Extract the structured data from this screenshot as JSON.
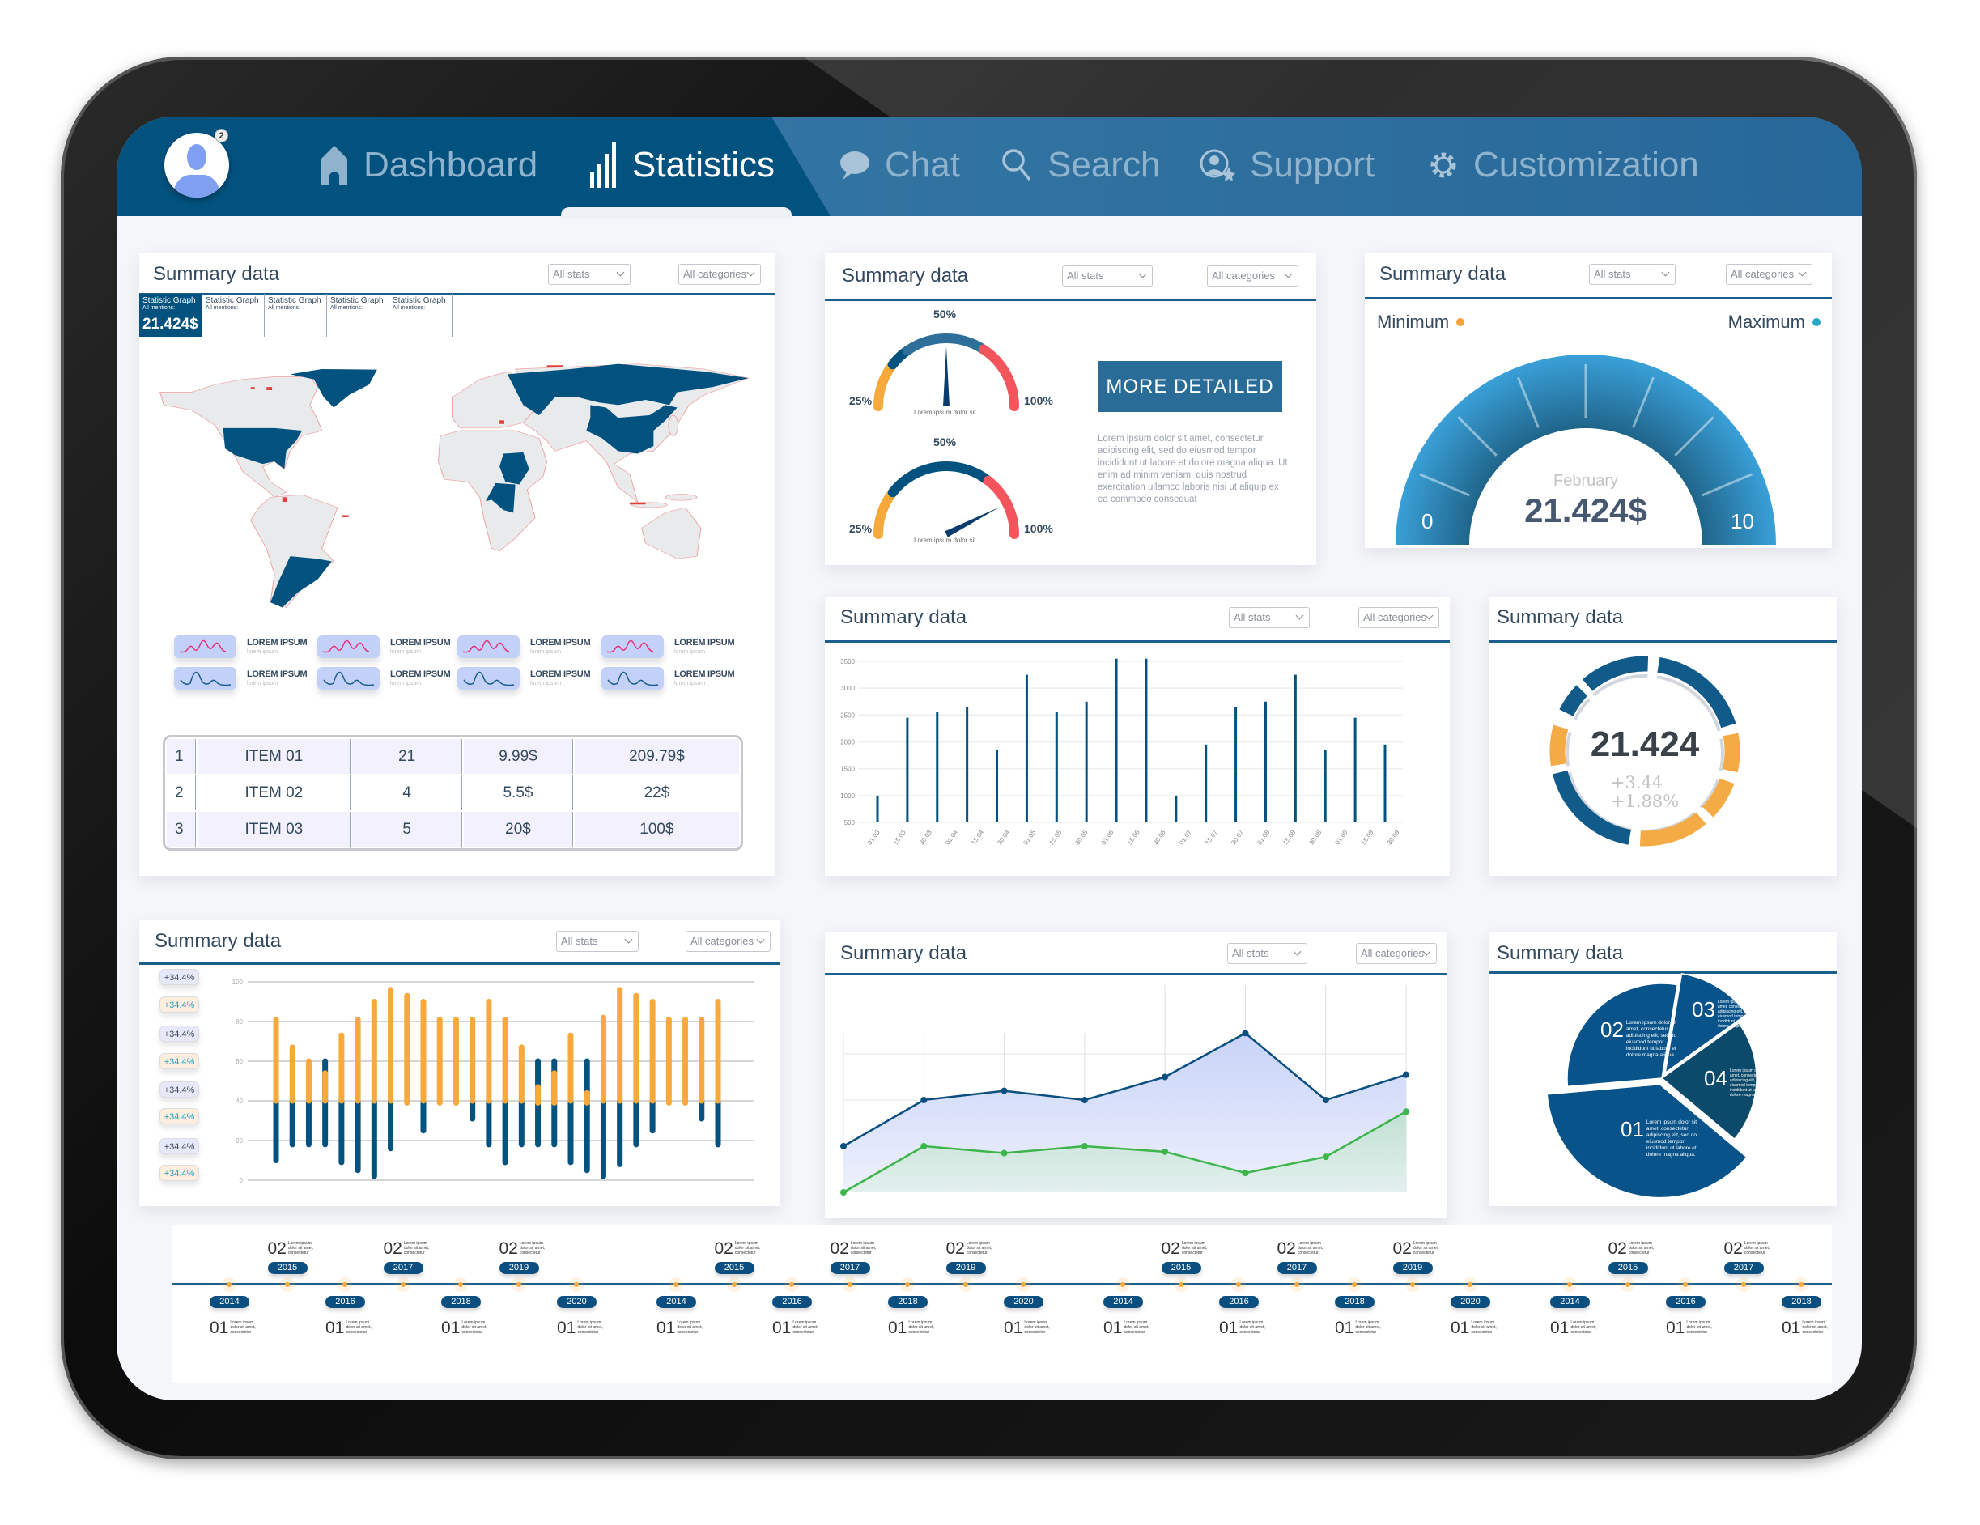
{
  "nav": {
    "notification_count": "2",
    "items": [
      {
        "label": "Dashboard",
        "icon": "home-icon"
      },
      {
        "label": "Statistics",
        "icon": "bar-chart-icon",
        "active": true
      },
      {
        "label": "Chat",
        "icon": "chat-bubble-icon"
      },
      {
        "label": "Search",
        "icon": "search-icon"
      },
      {
        "label": "Support",
        "icon": "support-icon"
      },
      {
        "label": "Customization",
        "icon": "gear-icon"
      }
    ]
  },
  "colors": {
    "navy": "#02527f",
    "orange": "#f7a93b",
    "red": "#f4545b",
    "light_blue": "#3aa0d8",
    "green": "#3db54a"
  },
  "map_panel": {
    "title": "Summary data",
    "stats_select": "All stats",
    "categories_select": "All categories",
    "tabs": [
      {
        "title": "Statistic Graph",
        "sub": "All mentions:",
        "value": "21.424$",
        "active": true
      },
      {
        "title": "Statistic Graph",
        "sub": "All mentions:"
      },
      {
        "title": "Statistic Graph",
        "sub": "All mentions:"
      },
      {
        "title": "Statistic Graph",
        "sub": "All mentions:"
      },
      {
        "title": "Statistic Graph",
        "sub": "All mentions:"
      }
    ],
    "sparklines": [
      {
        "title": "LOREM IPSUM",
        "sub": "lorem ipsum",
        "color": "#e8327c"
      },
      {
        "title": "LOREM IPSUM",
        "sub": "lorem ipsum",
        "color": "#e8327c"
      },
      {
        "title": "LOREM IPSUM",
        "sub": "lorem ipsum",
        "color": "#e8327c"
      },
      {
        "title": "LOREM IPSUM",
        "sub": "lorem ipsum",
        "color": "#e8327c"
      },
      {
        "title": "LOREM IPSUM",
        "sub": "lorem ipsum",
        "color": "#1a5d8c"
      },
      {
        "title": "LOREM IPSUM",
        "sub": "lorem ipsum",
        "color": "#1a5d8c"
      },
      {
        "title": "LOREM IPSUM",
        "sub": "lorem ipsum",
        "color": "#1a5d8c"
      },
      {
        "title": "LOREM IPSUM",
        "sub": "lorem ipsum",
        "color": "#1a5d8c"
      }
    ],
    "table": [
      [
        "1",
        "ITEM 01",
        "21",
        "9.99$",
        "209.79$"
      ],
      [
        "2",
        "ITEM 02",
        "4",
        "5.5$",
        "22$"
      ],
      [
        "3",
        "ITEM 03",
        "5",
        "20$",
        "100$"
      ]
    ]
  },
  "gauge_panel": {
    "title": "Summary data",
    "stats_select": "All stats",
    "categories_select": "All categories",
    "gauges": [
      {
        "label_min": "25%",
        "label_mid": "50%",
        "label_max": "100%",
        "caption": "Lorem ipsum  dolor sit",
        "needle_fraction": 0.5
      },
      {
        "label_min": "25%",
        "label_mid": "50%",
        "label_max": "100%",
        "caption": "Lorem ipsum  dolor sit",
        "needle_fraction": 0.85
      }
    ],
    "button": "MORE  DETAILED",
    "text": "Lorem ipsum dolor sit amet, consectetur adipiscing elit, sed do eiusmod tempor incididunt ut labore et dolore magna aliqua. Ut enim ad minim veniam, quis nostrud exercitation ullamco laboris nisi ut aliquip ex ea commodo consequat"
  },
  "meter_panel": {
    "title": "Summary data",
    "stats_select": "All stats",
    "categories_select": "All categories",
    "minimum": "Minimum",
    "maximum": "Maximum",
    "min_color": "#f7a23b",
    "max_color": "#28a9c9",
    "scale_min": "0",
    "scale_max": "10",
    "month": "February",
    "value": "21.424$"
  },
  "donut_panel": {
    "title": "Summary data",
    "value": "21.424",
    "delta": "+3.44",
    "delta_pct": "+1.88%"
  },
  "bars_panel": {
    "title": "Summary data",
    "stats_select": "All stats",
    "categories_select": "All categories"
  },
  "stacked_panel": {
    "title": "Summary data",
    "stats_select": "All stats",
    "categories_select": "All categories",
    "badges": [
      "+34.4%",
      "+34.4%",
      "+34.4%",
      "+34.4%",
      "+34.4%",
      "+34.4%",
      "+34.4%",
      "+34.4%"
    ]
  },
  "line_panel": {
    "title": "Summary data",
    "stats_select": "All stats",
    "categories_select": "All categories"
  },
  "pie_panel": {
    "title": "Summary data",
    "slices": [
      {
        "number": "01",
        "text": "Lorem ipsum dolor sit amet, consectetur adipiscing elit, sed do eiusmod tempor incididunt ut labore et dolore magna aliqua."
      },
      {
        "number": "02",
        "text": "Lorem ipsum dolor sit amet, consectetur adipiscing elit, sed do eiusmod tempor incididunt ut labore et dolore magna aliqua."
      },
      {
        "number": "03",
        "text": "Lorem ipsum dolor sit amet, consectetur adipiscing elit, sed do eiusmod tempor incididunt ut labore et dolore magna aliqua."
      },
      {
        "number": "04",
        "text": "Lorem ipsum dolor sit amet, consectetur adipiscing elit, sed do eiusmod tempor incididunt ut labore et dolore magna aliqua."
      }
    ]
  },
  "timeline": {
    "top_number": "02",
    "bottom_number": "01",
    "text": "Lorem ipsum dolor sit amet, consectetur",
    "groups": [
      [
        "2014",
        "2015",
        "2016",
        "2017",
        "2018",
        "2019",
        "2020"
      ],
      [
        "2014",
        "2015",
        "2016",
        "2017",
        "2018",
        "2019",
        "2020"
      ],
      [
        "2014",
        "2015",
        "2016",
        "2017",
        "2018",
        "2019",
        "2020"
      ],
      [
        "2014",
        "2015",
        "2016",
        "2017",
        "2018"
      ]
    ]
  },
  "chart_data": [
    {
      "type": "bar",
      "categories": [
        "01.03",
        "15.03",
        "30.03",
        "01.04",
        "15.04",
        "30.04",
        "01.05",
        "15.05",
        "30.05",
        "01.06",
        "15.06",
        "30.06",
        "01.07",
        "15.07",
        "30.07",
        "01.08",
        "15.08",
        "30.08",
        "01.09",
        "15.09",
        "30.09"
      ],
      "values": [
        1000,
        2450,
        2550,
        2650,
        1850,
        3250,
        2550,
        2750,
        3550,
        3550,
        1000,
        1950,
        2650,
        2750,
        3250,
        1850,
        2450,
        1950
      ],
      "yticks": [
        500,
        1000,
        1500,
        2000,
        2500,
        3000,
        3500
      ],
      "ylim": [
        500,
        3500
      ],
      "grid": true
    },
    {
      "type": "bar",
      "stacked_ranges": true,
      "yticks": [
        0,
        20,
        40,
        60,
        80,
        100
      ],
      "ylim": [
        0,
        100
      ],
      "grid": true,
      "blue_ranges": [
        [
          10,
          40
        ],
        [
          18,
          40
        ],
        [
          18,
          40
        ],
        [
          18,
          60
        ],
        [
          9,
          40
        ],
        [
          5,
          40
        ],
        [
          2,
          40
        ],
        [
          16,
          40
        ],
        null,
        [
          25,
          40
        ],
        null,
        null,
        [
          31,
          40
        ],
        [
          18,
          40
        ],
        [
          9,
          40
        ],
        [
          18,
          40
        ],
        [
          18,
          60
        ],
        [
          18,
          60
        ],
        [
          9,
          40
        ],
        [
          5,
          60
        ],
        [
          2,
          40
        ],
        [
          8,
          40
        ],
        [
          18,
          40
        ],
        [
          25,
          40
        ],
        null,
        null,
        [
          31,
          40
        ],
        [
          18,
          40
        ]
      ],
      "orange_ranges": [
        [
          40,
          81
        ],
        [
          40,
          67
        ],
        [
          40,
          60
        ],
        [
          40,
          54
        ],
        [
          40,
          73
        ],
        [
          40,
          81
        ],
        [
          40,
          90
        ],
        [
          40,
          96
        ],
        [
          39,
          93
        ],
        [
          40,
          90
        ],
        [
          39,
          81
        ],
        [
          39,
          81
        ],
        [
          40,
          81
        ],
        [
          40,
          90
        ],
        [
          40,
          81
        ],
        [
          40,
          67
        ],
        [
          39,
          47
        ],
        [
          39,
          54
        ],
        [
          40,
          73
        ],
        [
          39,
          44
        ],
        [
          40,
          82
        ],
        [
          40,
          96
        ],
        [
          40,
          93
        ],
        [
          40,
          90
        ],
        [
          39,
          81
        ],
        [
          39,
          81
        ],
        [
          40,
          81
        ],
        [
          40,
          90
        ]
      ]
    },
    {
      "type": "area",
      "x": [
        1,
        2,
        3,
        4,
        5,
        6,
        7,
        8
      ],
      "series": [
        {
          "values": [
            1.0,
            2.0,
            2.2,
            2.0,
            2.5,
            3.45,
            2.0,
            2.55
          ],
          "color": "#0b4f80"
        },
        {
          "values": [
            0.0,
            1.0,
            0.85,
            1.0,
            0.88,
            0.42,
            0.77,
            1.75
          ],
          "color": "#3db54a"
        }
      ],
      "ylim": [
        0,
        4
      ],
      "grid": true
    },
    {
      "type": "pie",
      "categories": [
        "01",
        "02",
        "03",
        "04"
      ],
      "values": [
        37.5,
        29,
        12.5,
        21
      ]
    }
  ]
}
